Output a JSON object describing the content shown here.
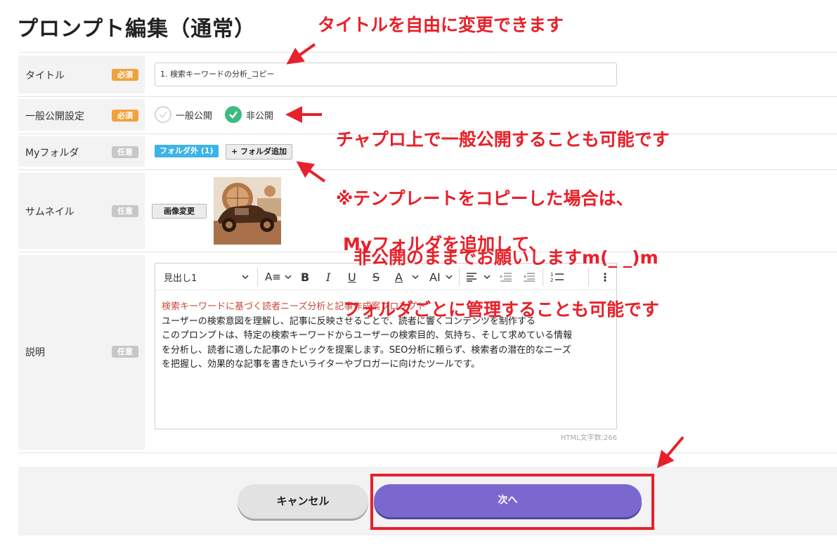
{
  "page": {
    "title": "プロンプト編集（通常）"
  },
  "rows": {
    "title": {
      "label": "タイトル",
      "badge": "必須",
      "value": "1. 検索キーワードの分析_コピー"
    },
    "visibility": {
      "label": "一般公開設定",
      "badge": "必須",
      "options": [
        {
          "label": "一般公開",
          "selected": false
        },
        {
          "label": "非公開",
          "selected": true
        }
      ]
    },
    "folder": {
      "label": "Myフォルダ",
      "badge": "任意",
      "tag": "フォルダ外 (1)",
      "add_button": "+ フォルダ追加"
    },
    "thumbnail": {
      "label": "サムネイル",
      "badge": "任意",
      "change_button": "画像変更"
    },
    "description": {
      "label": "説明",
      "badge": "任意",
      "toolbar": {
        "heading": "見出し1"
      },
      "content": {
        "heading": "検索キーワードに基づく読者ニーズ分析と記事作成案プロンプト",
        "line1": "ユーザーの検索意図を理解し、記事に反映させることで、読者に響くコンテンツを制作する",
        "paragraph_lines": [
          "このプロンプトは、特定の検索キーワードからユーザーの検索目的、気持ち、そして求めている情報",
          "を分析し、読者に適した記事のトピックを提案します。SEO分析に頼らず、検索者の潜在的なニーズ",
          "を把握し、効果的な記事を書きたいライターやブロガーに向けたツールです。"
        ]
      },
      "char_count": "HTML文字数:266"
    }
  },
  "footer": {
    "cancel_label": "キャンセル",
    "next_label": "次へ"
  },
  "annotations": {
    "title_note": "タイトルを自由に変更できます",
    "visibility_note": [
      "チャプロ上で一般公開することも可能です",
      "※テンプレートをコピーした場合は、",
      "　非公開のままでお願いしますm(_ _)m"
    ],
    "folder_note": [
      "Myフォルダを追加して、",
      "フォルダごとに管理することも可能です"
    ]
  },
  "colors": {
    "required_badge": "#f0a23c",
    "optional_badge": "#c7c7c7",
    "selected_radio": "#3fbb82",
    "folder_tag": "#3cb4e6",
    "next_button": "#7b68cf",
    "annotation_red": "#e8202a",
    "description_heading": "#c84a3c"
  }
}
